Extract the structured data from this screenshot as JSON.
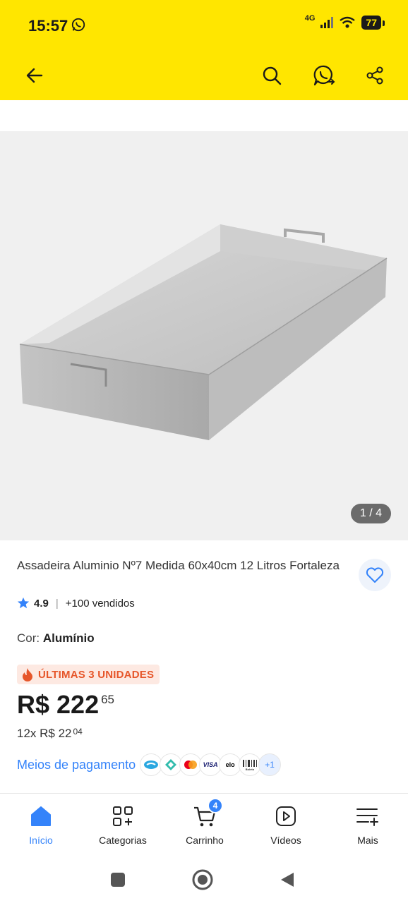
{
  "status_bar": {
    "time": "15:57",
    "network": "4G",
    "battery": "77"
  },
  "header": {
    "icons": [
      "back-arrow-icon",
      "search-icon",
      "whatsapp-share-icon",
      "share-icon"
    ]
  },
  "gallery": {
    "counter": "1 / 4"
  },
  "product": {
    "title": "Assadeira Aluminio Nº7 Medida 60x40cm 12 Litros Fortaleza",
    "rating": "4.9",
    "sold": "+100 vendidos",
    "color_label": "Cor:",
    "color_value": "Alumínio",
    "urgency": "ÚLTIMAS 3 UNIDADES",
    "price_main": "R$ 222",
    "price_cents": "65",
    "installments_main": "12x R$ 22",
    "installments_cents": "04",
    "payment_link": "Meios de pagamento",
    "payment_methods": [
      "mercado-pago",
      "pix",
      "mastercard",
      "VISA",
      "elo",
      "Boleto"
    ],
    "payment_more": "+1"
  },
  "bottom_nav": {
    "items": [
      {
        "label": "Início",
        "icon": "home-icon",
        "active": true
      },
      {
        "label": "Categorias",
        "icon": "categories-icon",
        "active": false
      },
      {
        "label": "Carrinho",
        "icon": "cart-icon",
        "active": false,
        "badge": "4"
      },
      {
        "label": "Vídeos",
        "icon": "video-icon",
        "active": false
      },
      {
        "label": "Mais",
        "icon": "menu-icon",
        "active": false
      }
    ]
  },
  "colors": {
    "brand_yellow": "#ffe600",
    "accent_blue": "#3483fa",
    "urgency_orange": "#e6562a"
  }
}
